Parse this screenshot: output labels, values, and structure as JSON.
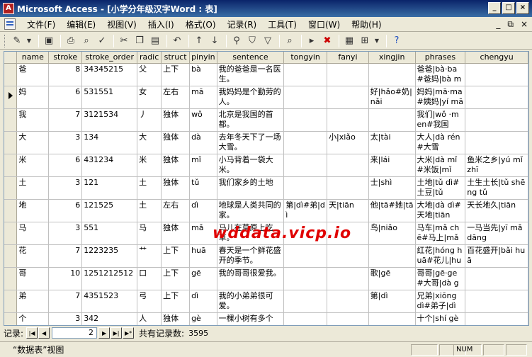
{
  "window": {
    "title": "Microsoft Access - [小学分年级汉字Word : 表]"
  },
  "menu": [
    "文件(F)",
    "编辑(E)",
    "视图(V)",
    "插入(I)",
    "格式(O)",
    "记录(R)",
    "工具(T)",
    "窗口(W)",
    "帮助(H)"
  ],
  "menu_controls": [
    "_",
    "⧉",
    "×"
  ],
  "toolbar_icons": [
    "design-view-icon",
    "save-icon",
    "print-icon",
    "print-preview-icon",
    "spelling-icon",
    "cut-icon",
    "copy-icon",
    "paste-icon",
    "undo-icon",
    "sort-ascending-icon",
    "sort-descending-icon",
    "filter-by-selection-icon",
    "filter-by-form-icon",
    "apply-filter-icon",
    "find-icon",
    "new-record-icon",
    "delete-record-icon",
    "database-window-icon",
    "new-object-icon",
    "help-icon"
  ],
  "table": {
    "columns": [
      "name",
      "stroke",
      "stroke_order",
      "radic",
      "struct",
      "pinyin",
      "sentence",
      "tongyin",
      "fanyi",
      "xingjin",
      "phrases",
      "chengyu"
    ],
    "rows": [
      [
        "爸",
        "8",
        "34345215",
        "父",
        "上下",
        "bà",
        "我的爸爸是一名医生。",
        "",
        "",
        "",
        "爸爸|bà·ba #爸妈|bà mā",
        ""
      ],
      [
        "妈",
        "6",
        "531551",
        "女",
        "左右",
        "mā",
        "我妈妈是个勤劳的人。",
        "",
        "",
        "好|hǎo#奶|nǎi",
        "妈妈|mā·ma #姨妈|yí mā",
        ""
      ],
      [
        "我",
        "7",
        "3121534",
        "丿",
        "独体",
        "wǒ",
        "北京是我国的首都。",
        "",
        "",
        "",
        "我们|wǒ ·men#我国",
        ""
      ],
      [
        "大",
        "3",
        "134",
        "大",
        "独体",
        "dà",
        "去年冬天下了一场大雪。",
        "",
        "小|xiǎo",
        "太|tài",
        "大人|dà rén#大雪",
        ""
      ],
      [
        "米",
        "6",
        "431234",
        "米",
        "独体",
        "mǐ",
        "小马背着一袋大米。",
        "",
        "",
        "来|lái",
        "大米|dà mǐ#米饭|mǐ",
        "鱼米之乡|yú mǐ zhī"
      ],
      [
        "土",
        "3",
        "121",
        "土",
        "独体",
        "tǔ",
        "我们家乡的土地",
        "",
        "",
        "士|shì",
        "土地|tǔ dì#土豆|tǔ",
        "土生土长|tǔ shēng tǔ"
      ],
      [
        "地",
        "6",
        "121525",
        "土",
        "左右",
        "dì",
        "地球是人类共同的家。",
        "第|dì#弟|dì",
        "天|tiān",
        "他|tā#她|tā",
        "大地|dà dì#天地|tiān",
        "天长地久|tiān"
      ],
      [
        "马",
        "3",
        "551",
        "马",
        "独体",
        "mǎ",
        "马儿在草原上吃草。",
        "",
        "",
        "鸟|niǎo",
        "马车|mǎ chē#马上|mǎ",
        "一马当先|yī mǎ dāng"
      ],
      [
        "花",
        "7",
        "1223235",
        "艹",
        "上下",
        "huā",
        "春天是一个鲜花盛开的季节。",
        "",
        "",
        "",
        "红花|hóng huā#花儿|huā",
        "百花盛开|bǎi huā"
      ],
      [
        "哥",
        "10",
        "1251212512",
        "口",
        "上下",
        "gē",
        "我的哥哥很爱我。",
        "",
        "",
        "歌|gē",
        "哥哥|gē·ge#大哥|dà gē",
        ""
      ],
      [
        "弟",
        "7",
        "4351523",
        "弓",
        "上下",
        "dì",
        "我的小弟弟很可爱。",
        "",
        "",
        "第|dì",
        "兄弟|xiōng dì#弟子|dì",
        ""
      ],
      [
        "个",
        "3",
        "342",
        "人",
        "独体",
        "gè",
        "一棵小树有多个",
        "",
        "",
        "",
        "十个|shí gè",
        ""
      ]
    ]
  },
  "watermark": "wddata.vicp.io",
  "nav": {
    "label": "记录:",
    "current": "2",
    "count_label": "共有记录数:",
    "count": "3595"
  },
  "status": {
    "text": "“数据表”视图",
    "num": "NUM"
  }
}
